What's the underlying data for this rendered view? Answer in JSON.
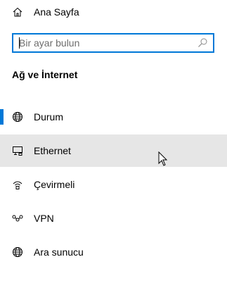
{
  "home": {
    "label": "Ana Sayfa",
    "icon": "home-icon"
  },
  "search": {
    "placeholder": "Bir ayar bulun",
    "icon": "search-icon"
  },
  "section": {
    "title": "Ağ ve İnternet"
  },
  "nav": {
    "items": [
      {
        "label": "Durum",
        "icon": "globe-icon",
        "selected": true
      },
      {
        "label": "Ethernet",
        "icon": "ethernet-icon",
        "hovered": true
      },
      {
        "label": "Çevirmeli",
        "icon": "dialup-icon"
      },
      {
        "label": "VPN",
        "icon": "vpn-icon"
      },
      {
        "label": "Ara sunucu",
        "icon": "globe-icon"
      }
    ]
  },
  "colors": {
    "accent": "#0078d7",
    "hover": "#e6e6e6"
  }
}
